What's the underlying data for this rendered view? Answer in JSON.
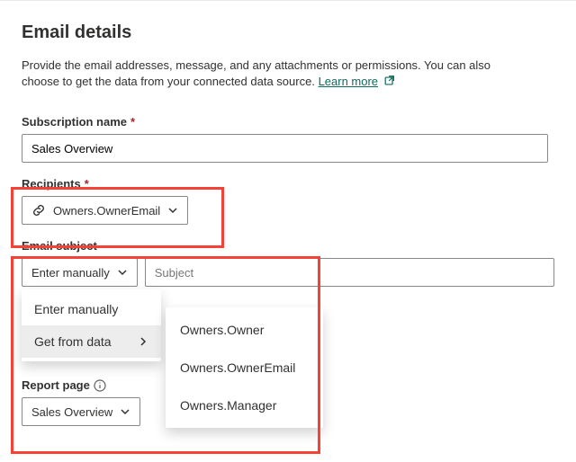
{
  "header": {
    "title": "Email details"
  },
  "description": {
    "text": "Provide the email addresses, message, and any attachments or permissions. You can also choose to get the data from your connected data source.",
    "learnMore": "Learn more"
  },
  "fields": {
    "subscriptionName": {
      "label": "Subscription name",
      "value": "Sales Overview"
    },
    "recipients": {
      "label": "Recipients",
      "chipValue": "Owners.OwnerEmail"
    },
    "emailSubject": {
      "label": "Email subject",
      "modeSelector": "Enter manually",
      "placeholder": "Subject",
      "value": ""
    },
    "reportPage": {
      "label": "Report page",
      "value": "Sales Overview"
    }
  },
  "dropdown": {
    "items": [
      {
        "label": "Enter manually",
        "hasSubmenu": false
      },
      {
        "label": "Get from data",
        "hasSubmenu": true
      }
    ],
    "submenu": [
      {
        "label": "Owners.Owner"
      },
      {
        "label": "Owners.OwnerEmail"
      },
      {
        "label": "Owners.Manager"
      }
    ]
  },
  "requiredMark": "*"
}
